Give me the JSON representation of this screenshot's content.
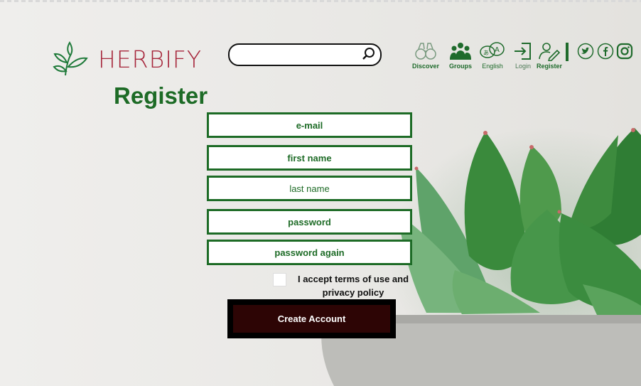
{
  "brand": {
    "name": "HERBIFY"
  },
  "search": {
    "placeholder": ""
  },
  "nav": {
    "discover": "Discover",
    "groups": "Groups",
    "english": "English",
    "login": "Login",
    "register": "Register"
  },
  "social": [
    "twitter-icon",
    "facebook-icon",
    "instagram-icon"
  ],
  "form": {
    "title": "Register",
    "email": "e-mail",
    "first_name": "first name",
    "last_name": "last name",
    "password": "password",
    "password_again": "password again",
    "terms": "I accept terms of use and privacy policy",
    "submit": "Create Account"
  },
  "colors": {
    "brand_red": "#a6263b",
    "green": "#1d6b26",
    "button": "#2d0505"
  }
}
